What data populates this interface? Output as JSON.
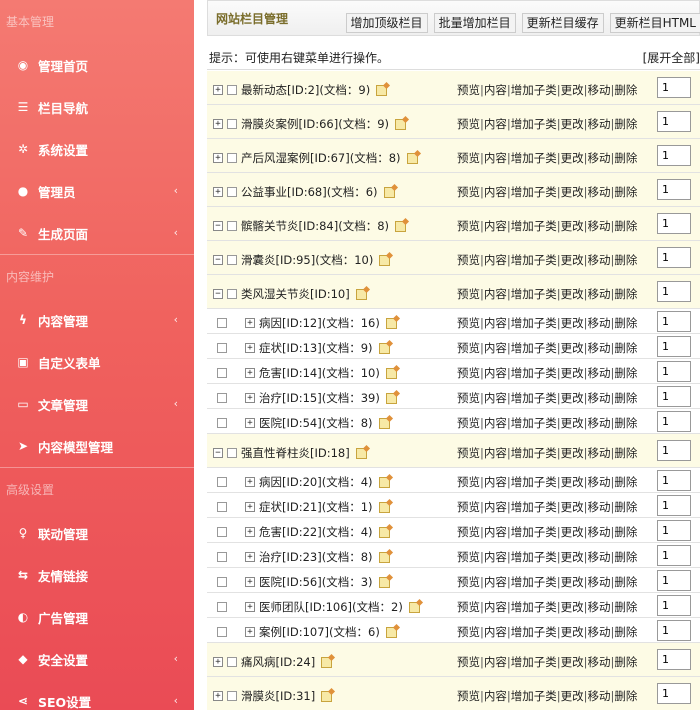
{
  "sidebar": {
    "sections": [
      "基本管理",
      "内容维护",
      "高级设置"
    ],
    "items": [
      {
        "label": "管理首页",
        "icon": "dashboard-icon",
        "chevron": false
      },
      {
        "label": "栏目导航",
        "icon": "list-icon",
        "chevron": false
      },
      {
        "label": "系统设置",
        "icon": "gear-icon",
        "chevron": false
      },
      {
        "label": "管理员",
        "icon": "user-icon",
        "chevron": true
      },
      {
        "label": "生成页面",
        "icon": "pencil-icon",
        "chevron": true
      },
      {
        "label": "内容管理",
        "icon": "bolt-icon",
        "chevron": true
      },
      {
        "label": "自定义表单",
        "icon": "form-icon",
        "chevron": false
      },
      {
        "label": "文章管理",
        "icon": "folder-icon",
        "chevron": true
      },
      {
        "label": "内容模型管理",
        "icon": "send-icon",
        "chevron": false
      },
      {
        "label": "联动管理",
        "icon": "bulb-icon",
        "chevron": false
      },
      {
        "label": "友情链接",
        "icon": "link-icon",
        "chevron": false
      },
      {
        "label": "广告管理",
        "icon": "globe-icon",
        "chevron": false
      },
      {
        "label": "安全设置",
        "icon": "shield-icon",
        "chevron": true
      },
      {
        "label": "SEO设置",
        "icon": "share-icon",
        "chevron": true
      }
    ]
  },
  "header": {
    "title": "网站栏目管理",
    "buttons": [
      "增加顶级栏目",
      "批量增加栏目",
      "更新栏目缓存",
      "更新栏目HTML"
    ]
  },
  "tip": "提示：可使用右键菜单进行操作。",
  "expand_all": "[展开全部]",
  "actions": [
    "预览",
    "内容",
    "增加子类",
    "更改",
    "移动",
    "删除"
  ],
  "rows": [
    {
      "kind": "top",
      "toggle": "+",
      "label": "最新动态[ID:2](文档：9)",
      "order": "1"
    },
    {
      "kind": "top",
      "toggle": "+",
      "label": "滑膜炎案例[ID:66](文档：9)",
      "order": "1"
    },
    {
      "kind": "top",
      "toggle": "+",
      "label": "产后风湿案例[ID:67](文档：8)",
      "order": "1"
    },
    {
      "kind": "top",
      "toggle": "+",
      "label": "公益事业[ID:68](文档：6)",
      "order": "1"
    },
    {
      "kind": "top",
      "toggle": "−",
      "label": "髌髂关节炎[ID:84](文档：8)",
      "order": "1"
    },
    {
      "kind": "top",
      "toggle": "−",
      "label": "滑囊炎[ID:95](文档：10)",
      "order": "1"
    },
    {
      "kind": "top",
      "toggle": "−",
      "label": "类风湿关节炎[ID:10]",
      "order": "1"
    },
    {
      "kind": "child",
      "toggle": "+",
      "label": "病因[ID:12](文档：16)",
      "order": "1"
    },
    {
      "kind": "child",
      "toggle": "+",
      "label": "症状[ID:13](文档：9)",
      "order": "1"
    },
    {
      "kind": "child",
      "toggle": "+",
      "label": "危害[ID:14](文档：10)",
      "order": "1"
    },
    {
      "kind": "child",
      "toggle": "+",
      "label": "治疗[ID:15](文档：39)",
      "order": "1"
    },
    {
      "kind": "child",
      "toggle": "+",
      "label": "医院[ID:54](文档：8)",
      "order": "1"
    },
    {
      "kind": "top",
      "toggle": "−",
      "label": "强直性脊柱炎[ID:18]",
      "order": "1"
    },
    {
      "kind": "child",
      "toggle": "+",
      "label": "病因[ID:20](文档：4)",
      "order": "1"
    },
    {
      "kind": "child",
      "toggle": "+",
      "label": "症状[ID:21](文档：1)",
      "order": "1"
    },
    {
      "kind": "child",
      "toggle": "+",
      "label": "危害[ID:22](文档：4)",
      "order": "1"
    },
    {
      "kind": "child",
      "toggle": "+",
      "label": "治疗[ID:23](文档：8)",
      "order": "1"
    },
    {
      "kind": "child",
      "toggle": "+",
      "label": "医院[ID:56](文档：3)",
      "order": "1"
    },
    {
      "kind": "child",
      "toggle": "+",
      "label": "医师团队[ID:106](文档：2)",
      "order": "1"
    },
    {
      "kind": "child",
      "toggle": "+",
      "label": "案例[ID:107](文档：6)",
      "order": "1"
    },
    {
      "kind": "top",
      "toggle": "+",
      "label": "痛风病[ID:24]",
      "order": "1"
    },
    {
      "kind": "top",
      "toggle": "+",
      "label": "滑膜炎[ID:31]",
      "order": "1"
    }
  ]
}
